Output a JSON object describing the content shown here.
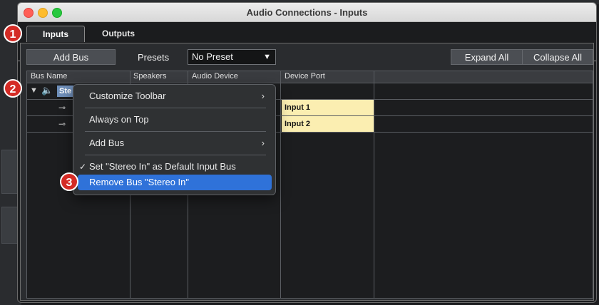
{
  "window": {
    "title": "Audio Connections - Inputs"
  },
  "tabs": [
    {
      "label": "Inputs"
    },
    {
      "label": "Outputs"
    }
  ],
  "toolbar": {
    "add_bus": "Add Bus",
    "presets_label": "Presets",
    "preset_value": "No Preset",
    "expand_all": "Expand All",
    "collapse_all": "Collapse All"
  },
  "table": {
    "headers": [
      "Bus Name",
      "Speakers",
      "Audio Device",
      "Device Port"
    ],
    "rows": [
      {
        "bus_name": "Ste",
        "device_port": ""
      },
      {
        "bus_name": "",
        "device_port": "Input 1"
      },
      {
        "bus_name": "",
        "device_port": "Input 2"
      }
    ]
  },
  "context_menu": {
    "items": [
      {
        "label": "Customize Toolbar",
        "submenu": true
      },
      {
        "label": "Always on Top"
      },
      {
        "label": "Add Bus",
        "submenu": true
      },
      {
        "label": "Set \"Stereo In\" as Default Input Bus",
        "checked": true
      },
      {
        "label": "Remove Bus \"Stereo In\"",
        "highlighted": true
      }
    ],
    "highlight_color": "#2f72d9"
  },
  "badges": [
    "1",
    "2",
    "3"
  ],
  "icons": [
    "triangle-down-icon",
    "speaker-icon",
    "connection-icon",
    "chevron-right-icon",
    "checkmark-icon",
    "dropdown-arrow-icon"
  ]
}
